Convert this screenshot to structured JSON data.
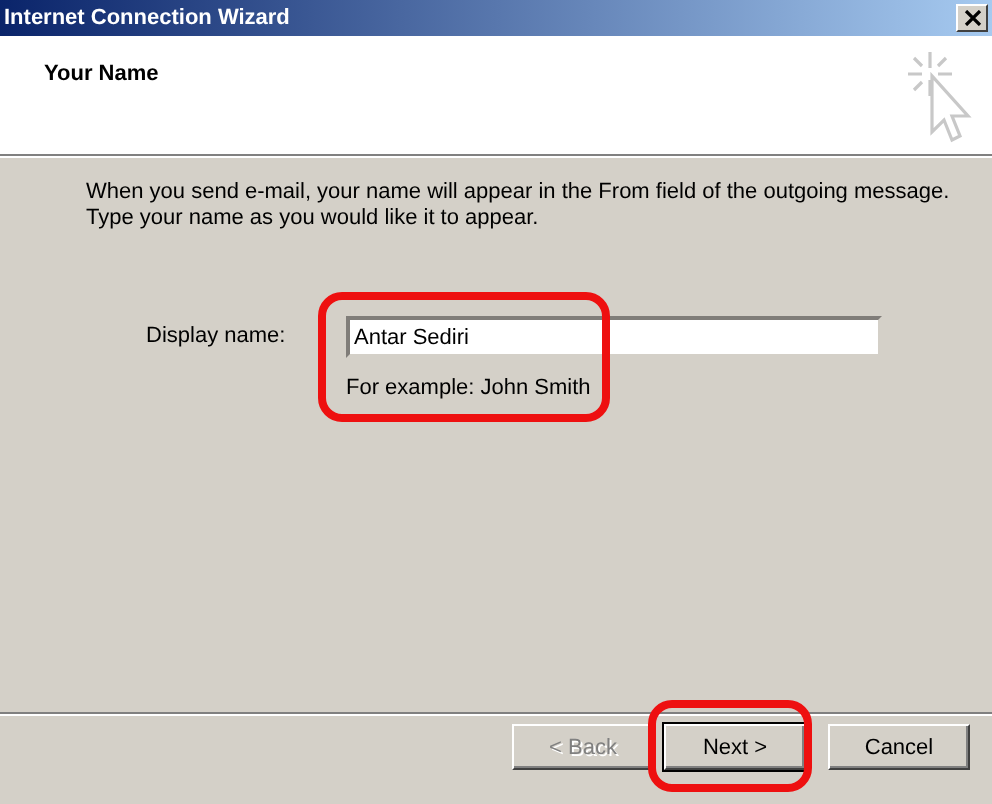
{
  "window": {
    "title": "Internet Connection Wizard"
  },
  "header": {
    "title": "Your Name"
  },
  "intro": [
    "When you send e-mail, your name will appear in the From field of the outgoing message.",
    "Type your name as you would like it to appear."
  ],
  "display_name": {
    "label": "Display name:",
    "value": "Antar Sediri",
    "hint": "For example: John Smith",
    "highlighted": true
  },
  "buttons": [
    {
      "label": "< Back",
      "disabled": true,
      "default": false,
      "highlighted": false
    },
    {
      "label": "Next >",
      "disabled": false,
      "default": true,
      "highlighted": true
    },
    {
      "label": "Cancel",
      "disabled": false,
      "default": false,
      "highlighted": false
    }
  ]
}
